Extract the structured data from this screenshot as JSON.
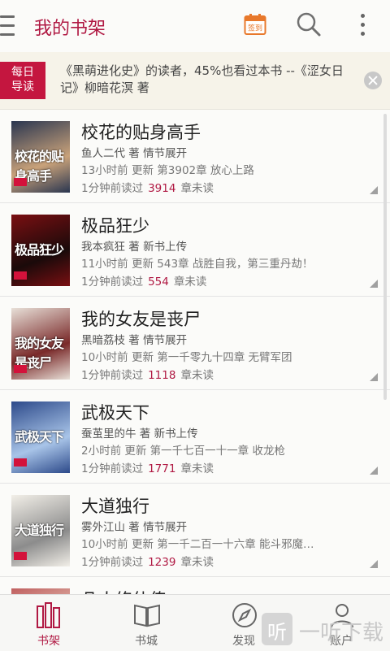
{
  "header": {
    "title": "我的书架",
    "checkin_label": "签到"
  },
  "tip": {
    "badge_line1": "每日",
    "badge_line2": "导读",
    "text": "《黑萌进化史》的读者，45%也看过本书 --《涩女日记》柳暗花溟 著"
  },
  "books": [
    {
      "title": "校花的贴身高手",
      "author_line": "鱼人二代 著  情节展开",
      "update_line": "13小时前  更新  第3902章 放心上路",
      "read_prefix": "1分钟前读过",
      "unread_count": "3914",
      "read_suffix": "章未读",
      "cover_text": "校花的贴身高手",
      "cover_colors": [
        "#2a3650",
        "#c9a27a"
      ]
    },
    {
      "title": "极品狂少",
      "author_line": "我本疯狂 著  新书上传",
      "update_line": "11小时前  更新  543章 战胜自我，第三重丹劫！",
      "read_prefix": "1分钟前读过",
      "unread_count": "554",
      "read_suffix": "章未读",
      "cover_text": "极品狂少",
      "cover_colors": [
        "#7a0f12",
        "#1a0a0a"
      ]
    },
    {
      "title": "我的女友是丧尸",
      "author_line": "黑暗荔枝 著  情节展开",
      "update_line": "10小时前  更新  第一千零九十四章 无臂军团",
      "read_prefix": "1分钟前读过",
      "unread_count": "1118",
      "read_suffix": "章未读",
      "cover_text": "我的女友是丧尸",
      "cover_colors": [
        "#e8e0d8",
        "#7a2a2a"
      ]
    },
    {
      "title": "武极天下",
      "author_line": "蚕茧里的牛 著  新书上传",
      "update_line": "2小时前  更新  第一千七百一十一章 收龙枪",
      "read_prefix": "1分钟前读过",
      "unread_count": "1771",
      "read_suffix": "章未读",
      "cover_text": "武极天下",
      "cover_colors": [
        "#2d4a8a",
        "#a8c4e8"
      ]
    },
    {
      "title": "大道独行",
      "author_line": "雾外江山 著  情节展开",
      "update_line": "10小时前  更新  第一千二百一十六章 能斗邪魔…",
      "read_prefix": "1分钟前读过",
      "unread_count": "1239",
      "read_suffix": "章未读",
      "cover_text": "大道独行",
      "cover_colors": [
        "#f2efe8",
        "#8c8c8c"
      ]
    },
    {
      "title": "凡人修仙传",
      "author_line": "",
      "update_line": "",
      "read_prefix": "",
      "unread_count": "",
      "read_suffix": "",
      "cover_text": "",
      "cover_colors": [
        "#c06060",
        "#e8d0c0"
      ]
    }
  ],
  "tabs": [
    {
      "label": "书架",
      "icon": "bookshelf-icon",
      "active": true
    },
    {
      "label": "书城",
      "icon": "open-book-icon",
      "active": false
    },
    {
      "label": "发现",
      "icon": "compass-icon",
      "active": false
    },
    {
      "label": "账户",
      "icon": "user-icon",
      "active": false
    }
  ],
  "watermark": {
    "badge": "听",
    "text": "一听下载"
  },
  "colors": {
    "accent": "#b01943",
    "badge": "#c4163f",
    "checkin": "#e8782b"
  }
}
